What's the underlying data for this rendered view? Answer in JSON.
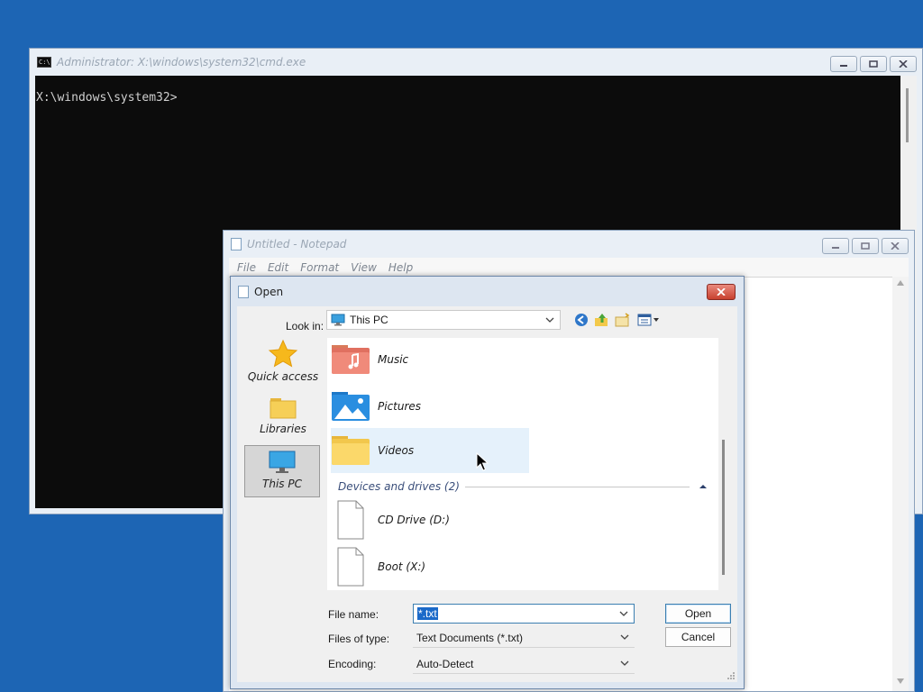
{
  "cmd": {
    "title": "Administrator: X:\\windows\\system32\\cmd.exe",
    "icon_text": "C:\\",
    "prompt": "X:\\windows\\system32>"
  },
  "notepad": {
    "title": "Untitled - Notepad",
    "menu": [
      "File",
      "Edit",
      "Format",
      "View",
      "Help"
    ]
  },
  "dialog": {
    "title": "Open",
    "look_in_label": "Look in:",
    "look_in_value": "This PC",
    "toolbar_icons": [
      "back-icon",
      "up-folder-icon",
      "new-folder-icon",
      "view-menu-icon"
    ],
    "places": [
      {
        "label": "Quick access",
        "icon": "star-icon"
      },
      {
        "label": "Libraries",
        "icon": "libraries-folder-icon"
      },
      {
        "label": "This PC",
        "icon": "monitor-icon",
        "selected": true
      }
    ],
    "files": [
      {
        "name": "Music",
        "icon": "music-folder-icon"
      },
      {
        "name": "Pictures",
        "icon": "pictures-folder-icon"
      },
      {
        "name": "Videos",
        "icon": "folder-icon",
        "hovered": true
      }
    ],
    "group_header": "Devices and drives (2)",
    "drives": [
      {
        "name": "CD Drive (D:)",
        "icon": "file-icon"
      },
      {
        "name": "Boot (X:)",
        "icon": "file-icon"
      }
    ],
    "file_name_label": "File name:",
    "file_name_value": "*.txt",
    "files_of_type_label": "Files of type:",
    "files_of_type_value": "Text Documents (*.txt)",
    "encoding_label": "Encoding:",
    "encoding_value": "Auto-Detect",
    "open_button": "Open",
    "cancel_button": "Cancel"
  },
  "colors": {
    "desktop": "#1d65b4",
    "console_bg": "#0c0c0c",
    "hover": "#e5f1fb",
    "selection": "#1b6ac9"
  }
}
